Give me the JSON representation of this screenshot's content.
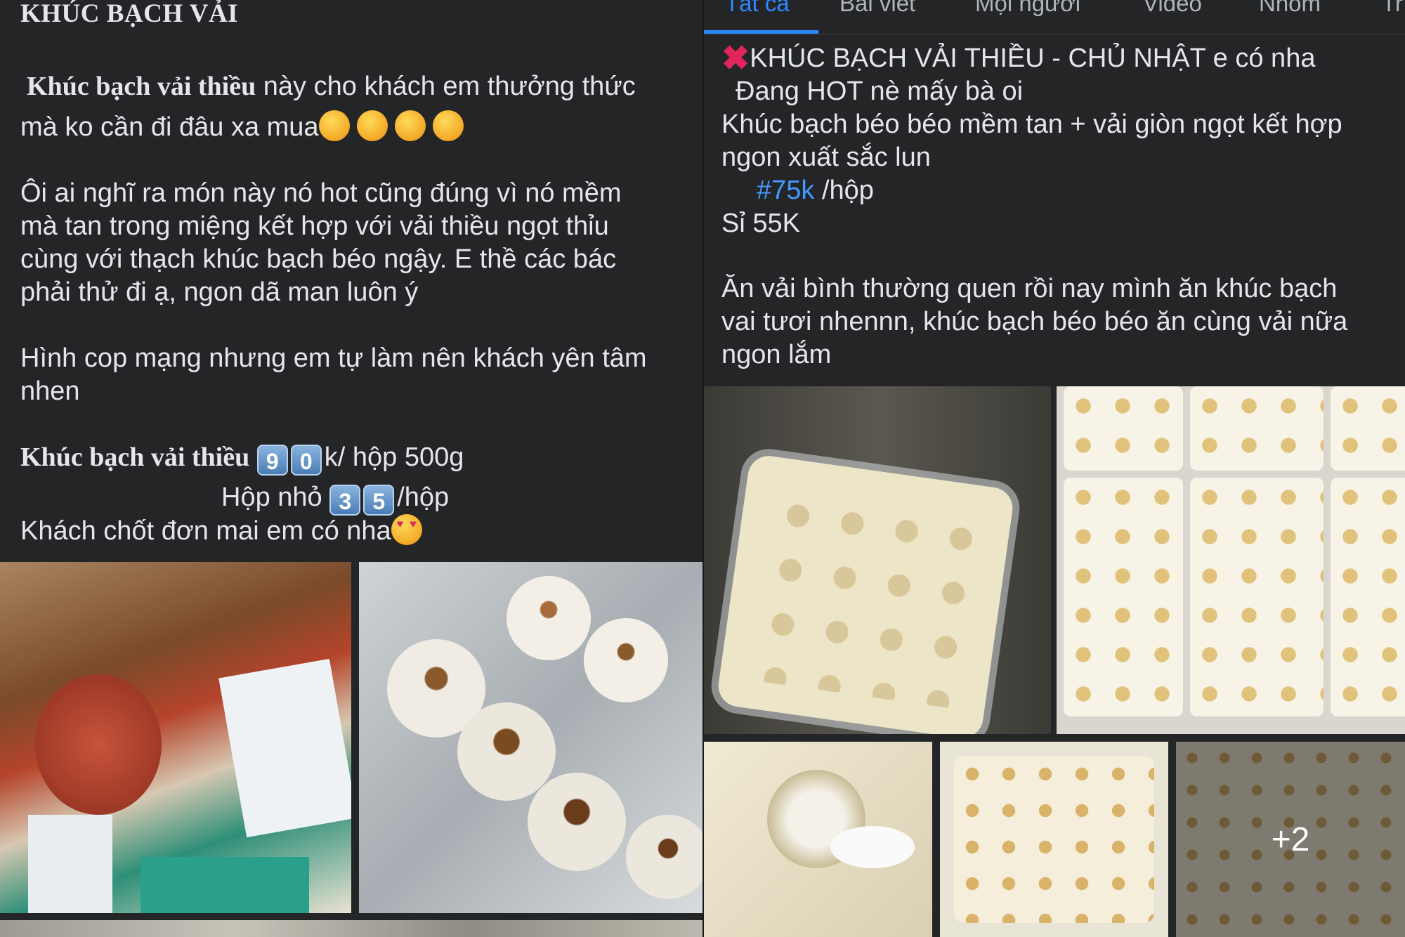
{
  "left_post": {
    "title": "KHÚC BẠCH VẢI",
    "intro_bold": "Khúc bạch vải thiều",
    "intro_rest": " này cho khách em thưởng thức",
    "intro_line2": "mà ko cần đi đâu xa mua",
    "para2": [
      "Ôi ai nghĩ ra món này nó hot cũng đúng vì nó mềm",
      "mà tan trong miệng kết hợp với vải thiều ngọt thỉu",
      "cùng với thạch khúc bạch béo ngậy. E thề các bác",
      "phải thử đi ạ, ngon dã man luôn ý"
    ],
    "para3": [
      "Hình cop mạng nhưng em tự làm nên khách yên tâm",
      "nhen"
    ],
    "price_bold": "Khúc bạch vải thiều",
    "price_keys": [
      "9",
      "0"
    ],
    "price_rest": "k/ hộp 500g",
    "small_label": "Hộp nhỏ",
    "small_keys": [
      "3",
      "5"
    ],
    "small_rest": "/hộp",
    "closing": "Khách chốt đơn mai em có nha"
  },
  "right_post": {
    "tabs": [
      "Tất cả",
      "Bài viết",
      "Mọi người",
      "Video",
      "Nhóm",
      "Tr"
    ],
    "line1": "KHÚC BẠCH VẢI THIỀU  - CHỦ NHẬT  e có nha",
    "line2": "Đang HOT nè mấy bà oi",
    "line3": "Khúc bạch béo béo mềm tan + vải giòn ngọt kết hợp",
    "line4": "ngon xuất sắc lun",
    "hashtag": "#75k",
    "price_unit": " /hộp",
    "line6": "Sỉ 55K",
    "para2": [
      "Ăn vải bình thường quen rồi nay mình ăn khúc bạch",
      "vai tươi nhennn, khúc bạch béo béo ăn cùng vải nữa",
      "ngon lắm"
    ],
    "more_photos": "+2"
  },
  "colors": {
    "background": "#242526",
    "text": "#e4e6eb",
    "accent": "#2d88ff"
  }
}
